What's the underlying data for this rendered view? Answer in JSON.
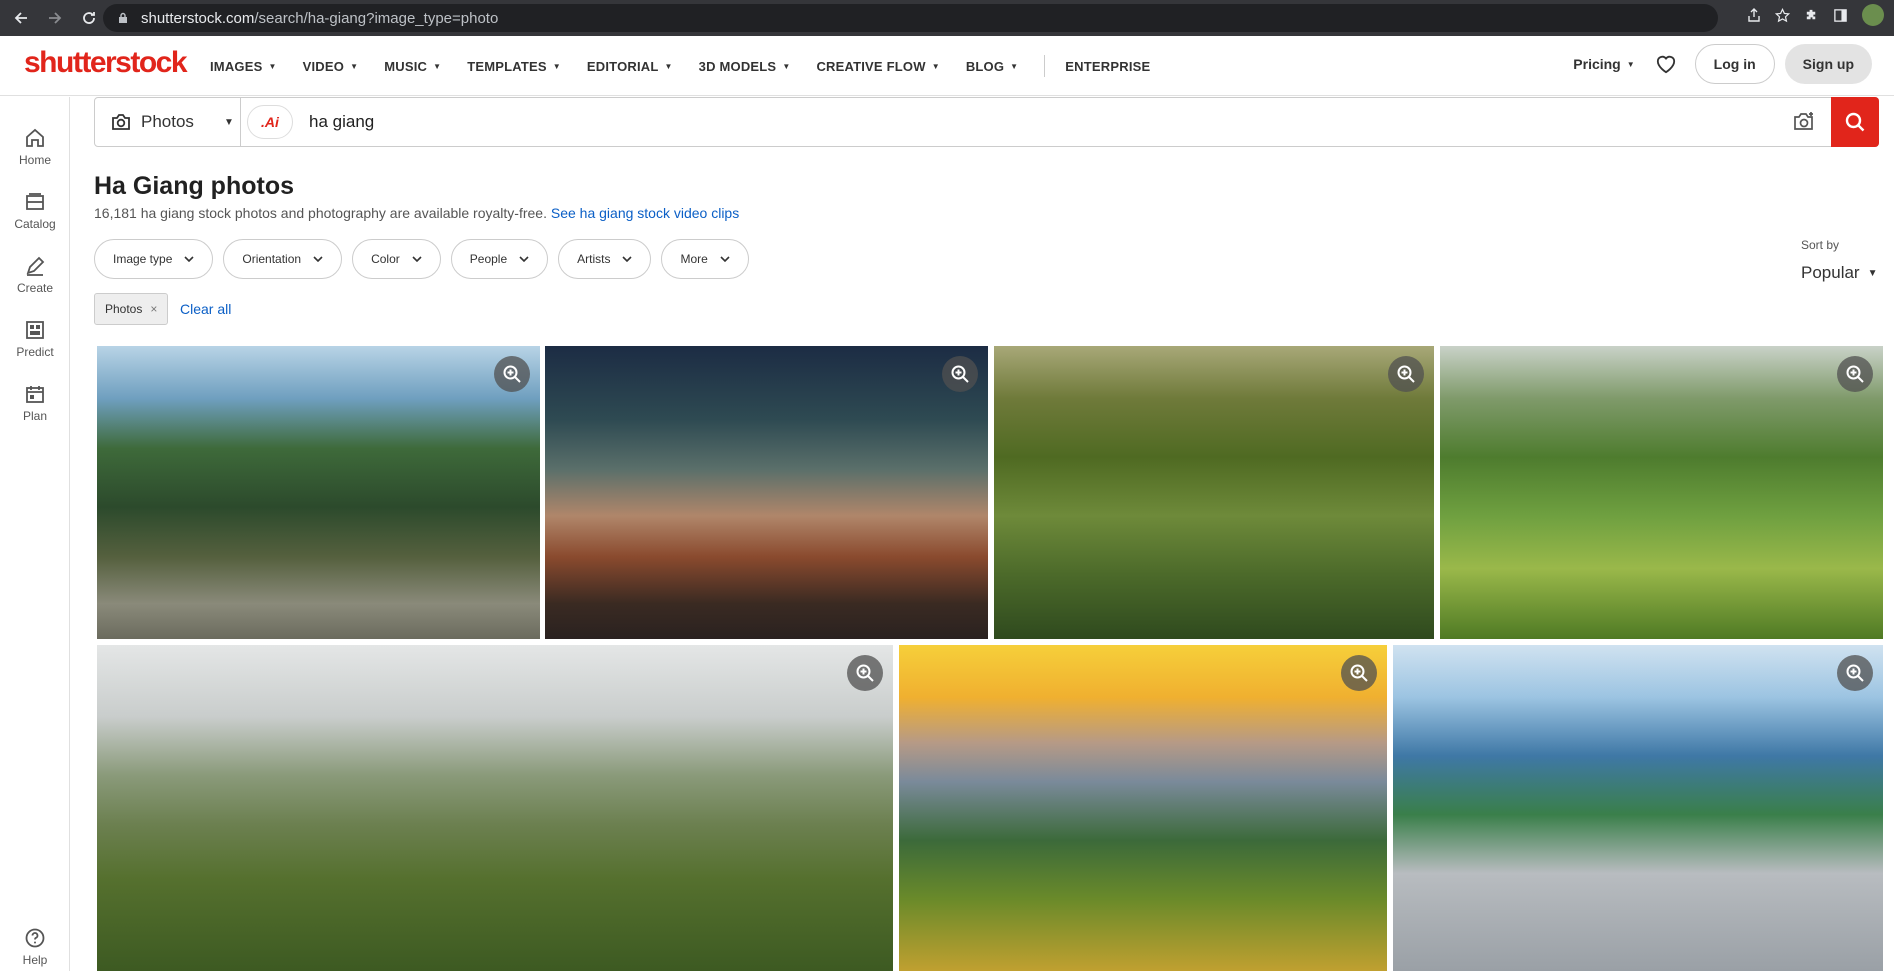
{
  "browser": {
    "url_domain": "shutterstock.com",
    "url_path": "/search/ha-giang?image_type=photo"
  },
  "logo": "shutterstock",
  "nav": {
    "items": [
      "IMAGES",
      "VIDEO",
      "MUSIC",
      "TEMPLATES",
      "EDITORIAL",
      "3D MODELS",
      "CREATIVE FLOW",
      "BLOG"
    ],
    "enterprise": "ENTERPRISE",
    "pricing": "Pricing",
    "login": "Log in",
    "signup": "Sign up"
  },
  "sidebar": {
    "items": [
      "Home",
      "Catalog",
      "Create",
      "Predict",
      "Plan"
    ],
    "help": "Help"
  },
  "search": {
    "type": "Photos",
    "ai_badge": ".Ai",
    "query": "ha giang"
  },
  "results": {
    "title": "Ha Giang photos",
    "summary": "16,181 ha giang stock photos and photography are available royalty-free.",
    "video_link": "See ha giang stock video clips"
  },
  "filters": [
    "Image type",
    "Orientation",
    "Color",
    "People",
    "Artists",
    "More"
  ],
  "sort": {
    "label": "Sort by",
    "value": "Popular"
  },
  "active_filter": "Photos",
  "clear_all": "Clear all",
  "colors": {
    "brand": "#e1251b",
    "link": "#0b5fc6"
  }
}
